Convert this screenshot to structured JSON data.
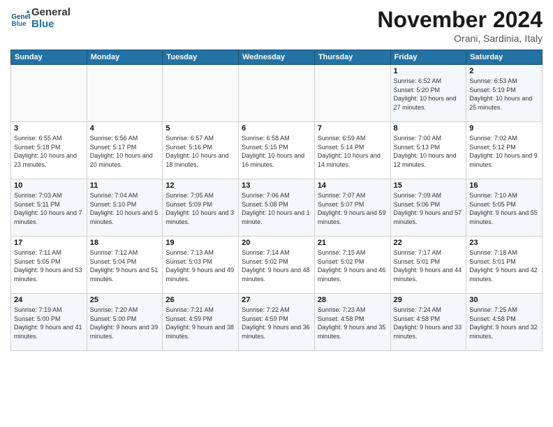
{
  "logo": {
    "text_general": "General",
    "text_blue": "Blue"
  },
  "header": {
    "month": "November 2024",
    "location": "Orani, Sardinia, Italy"
  },
  "days_of_week": [
    "Sunday",
    "Monday",
    "Tuesday",
    "Wednesday",
    "Thursday",
    "Friday",
    "Saturday"
  ],
  "weeks": [
    [
      {
        "day": "",
        "info": ""
      },
      {
        "day": "",
        "info": ""
      },
      {
        "day": "",
        "info": ""
      },
      {
        "day": "",
        "info": ""
      },
      {
        "day": "",
        "info": ""
      },
      {
        "day": "1",
        "info": "Sunrise: 6:52 AM\nSunset: 5:20 PM\nDaylight: 10 hours and 27 minutes."
      },
      {
        "day": "2",
        "info": "Sunrise: 6:53 AM\nSunset: 5:19 PM\nDaylight: 10 hours and 25 minutes."
      }
    ],
    [
      {
        "day": "3",
        "info": "Sunrise: 6:55 AM\nSunset: 5:18 PM\nDaylight: 10 hours and 23 minutes."
      },
      {
        "day": "4",
        "info": "Sunrise: 6:56 AM\nSunset: 5:17 PM\nDaylight: 10 hours and 20 minutes."
      },
      {
        "day": "5",
        "info": "Sunrise: 6:57 AM\nSunset: 5:16 PM\nDaylight: 10 hours and 18 minutes."
      },
      {
        "day": "6",
        "info": "Sunrise: 6:58 AM\nSunset: 5:15 PM\nDaylight: 10 hours and 16 minutes."
      },
      {
        "day": "7",
        "info": "Sunrise: 6:59 AM\nSunset: 5:14 PM\nDaylight: 10 hours and 14 minutes."
      },
      {
        "day": "8",
        "info": "Sunrise: 7:00 AM\nSunset: 5:13 PM\nDaylight: 10 hours and 12 minutes."
      },
      {
        "day": "9",
        "info": "Sunrise: 7:02 AM\nSunset: 5:12 PM\nDaylight: 10 hours and 9 minutes."
      }
    ],
    [
      {
        "day": "10",
        "info": "Sunrise: 7:03 AM\nSunset: 5:11 PM\nDaylight: 10 hours and 7 minutes."
      },
      {
        "day": "11",
        "info": "Sunrise: 7:04 AM\nSunset: 5:10 PM\nDaylight: 10 hours and 5 minutes."
      },
      {
        "day": "12",
        "info": "Sunrise: 7:05 AM\nSunset: 5:09 PM\nDaylight: 10 hours and 3 minutes."
      },
      {
        "day": "13",
        "info": "Sunrise: 7:06 AM\nSunset: 5:08 PM\nDaylight: 10 hours and 1 minute."
      },
      {
        "day": "14",
        "info": "Sunrise: 7:07 AM\nSunset: 5:07 PM\nDaylight: 9 hours and 59 minutes."
      },
      {
        "day": "15",
        "info": "Sunrise: 7:09 AM\nSunset: 5:06 PM\nDaylight: 9 hours and 57 minutes."
      },
      {
        "day": "16",
        "info": "Sunrise: 7:10 AM\nSunset: 5:05 PM\nDaylight: 9 hours and 55 minutes."
      }
    ],
    [
      {
        "day": "17",
        "info": "Sunrise: 7:11 AM\nSunset: 5:05 PM\nDaylight: 9 hours and 53 minutes."
      },
      {
        "day": "18",
        "info": "Sunrise: 7:12 AM\nSunset: 5:04 PM\nDaylight: 9 hours and 51 minutes."
      },
      {
        "day": "19",
        "info": "Sunrise: 7:13 AM\nSunset: 5:03 PM\nDaylight: 9 hours and 49 minutes."
      },
      {
        "day": "20",
        "info": "Sunrise: 7:14 AM\nSunset: 5:02 PM\nDaylight: 9 hours and 48 minutes."
      },
      {
        "day": "21",
        "info": "Sunrise: 7:15 AM\nSunset: 5:02 PM\nDaylight: 9 hours and 46 minutes."
      },
      {
        "day": "22",
        "info": "Sunrise: 7:17 AM\nSunset: 5:01 PM\nDaylight: 9 hours and 44 minutes."
      },
      {
        "day": "23",
        "info": "Sunrise: 7:18 AM\nSunset: 5:01 PM\nDaylight: 9 hours and 42 minutes."
      }
    ],
    [
      {
        "day": "24",
        "info": "Sunrise: 7:19 AM\nSunset: 5:00 PM\nDaylight: 9 hours and 41 minutes."
      },
      {
        "day": "25",
        "info": "Sunrise: 7:20 AM\nSunset: 5:00 PM\nDaylight: 9 hours and 39 minutes."
      },
      {
        "day": "26",
        "info": "Sunrise: 7:21 AM\nSunset: 4:59 PM\nDaylight: 9 hours and 38 minutes."
      },
      {
        "day": "27",
        "info": "Sunrise: 7:22 AM\nSunset: 4:59 PM\nDaylight: 9 hours and 36 minutes."
      },
      {
        "day": "28",
        "info": "Sunrise: 7:23 AM\nSunset: 4:58 PM\nDaylight: 9 hours and 35 minutes."
      },
      {
        "day": "29",
        "info": "Sunrise: 7:24 AM\nSunset: 4:58 PM\nDaylight: 9 hours and 33 minutes."
      },
      {
        "day": "30",
        "info": "Sunrise: 7:25 AM\nSunset: 4:58 PM\nDaylight: 9 hours and 32 minutes."
      }
    ]
  ]
}
